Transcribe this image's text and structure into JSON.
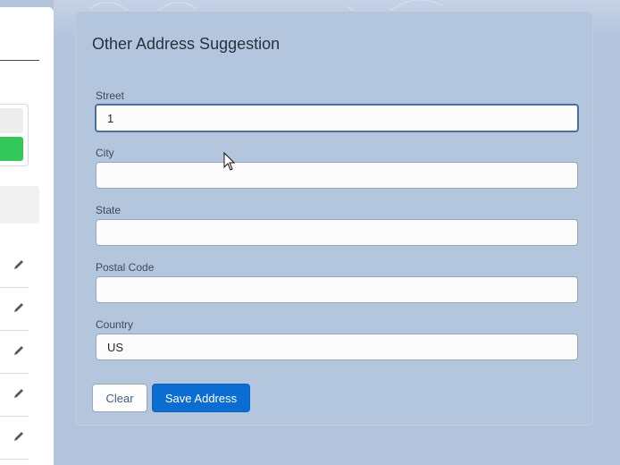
{
  "modal": {
    "title": "Other Address Suggestion",
    "fields": [
      {
        "label": "Street",
        "value": "1",
        "placeholder": ""
      },
      {
        "label": "City",
        "value": "",
        "placeholder": ""
      },
      {
        "label": "State",
        "value": "",
        "placeholder": ""
      },
      {
        "label": "Postal Code",
        "value": "",
        "placeholder": ""
      },
      {
        "label": "Country",
        "value": "US",
        "placeholder": ""
      }
    ],
    "buttons": {
      "clear": "Clear",
      "save": "Save Address"
    }
  },
  "left_panel": {
    "row_icons": [
      "pencil-icon",
      "pencil-icon",
      "pencil-icon",
      "pencil-icon",
      "pencil-icon"
    ]
  },
  "colors": {
    "primary_button": "#0b6dd1",
    "background": "#b3c3dc",
    "status_green": "#34c759"
  }
}
